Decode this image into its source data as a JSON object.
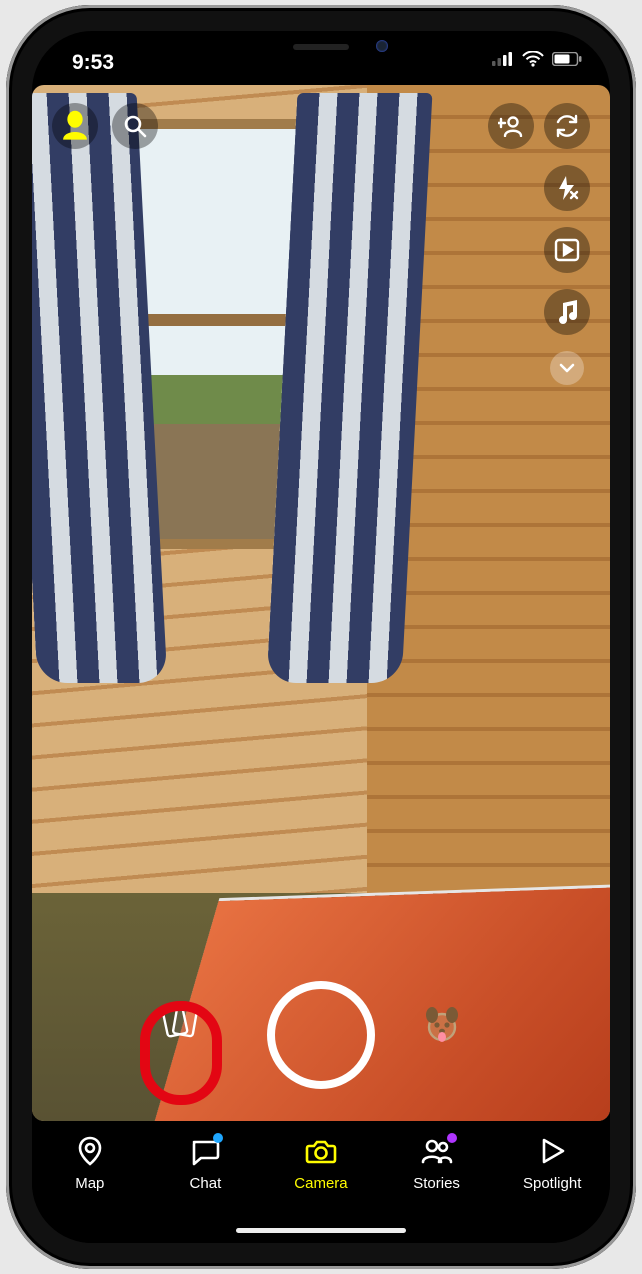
{
  "status": {
    "time": "9:53"
  },
  "top": {
    "avatar_icon": "bitmoji-avatar",
    "search_icon": "search",
    "add_friend_icon": "add-friend",
    "right_icons": [
      "camera-flip",
      "flash-off",
      "media-roll",
      "music",
      "expand-toolbar"
    ]
  },
  "shutter": {
    "memories_icon": "memories-cards",
    "lenses_icon": "dog-lens-smiley"
  },
  "annotation": {
    "target": "memories-button",
    "color": "#e30613"
  },
  "nav": {
    "items": [
      {
        "key": "map",
        "label": "Map",
        "icon": "pin",
        "active": false,
        "badge": null
      },
      {
        "key": "chat",
        "label": "Chat",
        "icon": "chat-bubble",
        "active": false,
        "badge": "blue"
      },
      {
        "key": "camera",
        "label": "Camera",
        "icon": "camera",
        "active": true,
        "badge": null
      },
      {
        "key": "stories",
        "label": "Stories",
        "icon": "people",
        "active": false,
        "badge": "purple"
      },
      {
        "key": "spotlight",
        "label": "Spotlight",
        "icon": "play",
        "active": false,
        "badge": null
      }
    ]
  }
}
